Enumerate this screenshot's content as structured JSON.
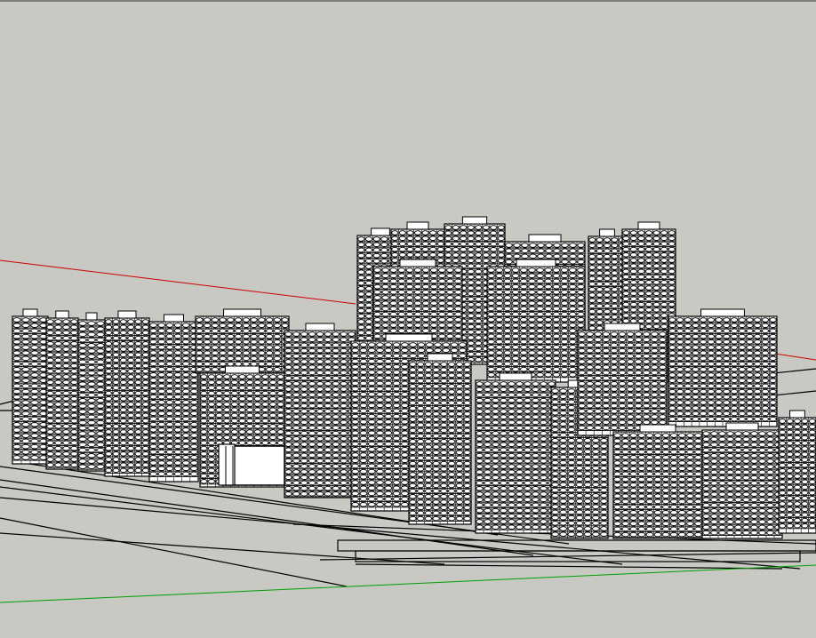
{
  "viewport": {
    "background_color": "#c9c9c3",
    "edge_color": "#000000",
    "face_color": "#ffffff",
    "axes": {
      "red_axis_color": "#cc0000",
      "green_axis_color": "#00a000"
    }
  }
}
